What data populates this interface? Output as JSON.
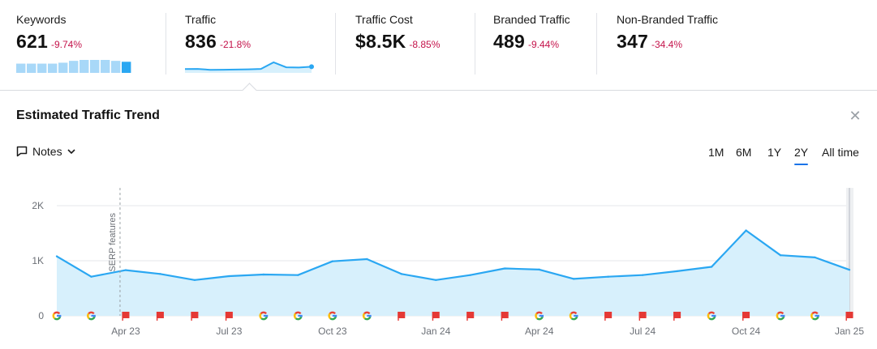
{
  "metrics": [
    {
      "label": "Keywords",
      "value": "621",
      "delta": "-9.74%"
    },
    {
      "label": "Traffic",
      "value": "836",
      "delta": "-21.8%"
    },
    {
      "label": "Traffic Cost",
      "value": "$8.5K",
      "delta": "-8.85%"
    },
    {
      "label": "Branded Traffic",
      "value": "489",
      "delta": "-9.44%"
    },
    {
      "label": "Non-Branded Traffic",
      "value": "347",
      "delta": "-34.4%"
    }
  ],
  "sparklines": {
    "keywords_bars": [
      10,
      10,
      10,
      10,
      11,
      13,
      14,
      14,
      14,
      13,
      12
    ],
    "traffic_line": [
      736,
      740,
      700,
      705,
      712,
      720,
      740,
      1030,
      812,
      800,
      836
    ]
  },
  "panel": {
    "title": "Estimated Traffic Trend",
    "close_icon": "close-icon",
    "notes_label": "Notes",
    "ranges": [
      "1M",
      "6M",
      "1Y",
      "2Y",
      "All time"
    ],
    "active_range": "2Y"
  },
  "colors": {
    "line": "#2aa7f2",
    "fill": "#d7f0fc",
    "bar": "#a8d8f8",
    "bar_last": "#2aa7f2",
    "delta_negative": "#c4124a",
    "google_blue": "#4285f4",
    "google_red": "#ea4335",
    "google_yellow": "#fbbc05",
    "google_green": "#34a853",
    "flag_red": "#e53935",
    "active_tab_underline": "#1a73e8"
  },
  "chart_data": {
    "type": "area",
    "series": [
      {
        "values": [
          1080,
          710,
          830,
          760,
          650,
          720,
          750,
          740,
          990,
          1030,
          760,
          650,
          740,
          860,
          840,
          670,
          710,
          740,
          810,
          890,
          1550,
          1100,
          1060,
          836
        ]
      }
    ],
    "y_ticks": [
      "0",
      "1K",
      "2K"
    ],
    "y_tick_values": [
      0,
      1000,
      2000
    ],
    "ylim": [
      0,
      2000
    ],
    "x_tick_labels": [
      "Apr 23",
      "Jul 23",
      "Oct 23",
      "Jan 24",
      "Apr 24",
      "Jul 24",
      "Oct 24",
      "Jan 25"
    ],
    "x_tick_points": [
      2,
      5,
      8,
      11,
      14,
      17,
      20,
      23
    ],
    "annotation": {
      "label": "SERP features",
      "point": 2
    },
    "markers": [
      "google",
      "google",
      "flag",
      "flag",
      "flag",
      "flag",
      "google",
      "google",
      "google",
      "google",
      "flag",
      "flag",
      "flag",
      "flag",
      "google",
      "google",
      "flag",
      "flag",
      "flag",
      "google",
      "flag",
      "google",
      "google",
      "flag"
    ],
    "grid": true
  }
}
